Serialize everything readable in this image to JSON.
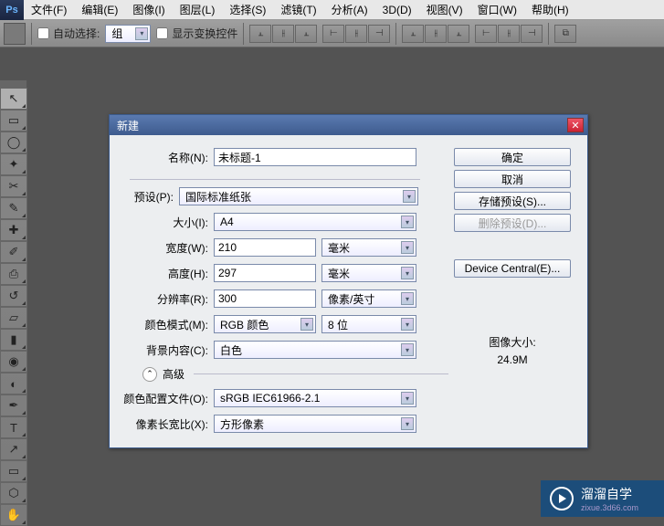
{
  "menubar": {
    "items": [
      "文件(F)",
      "编辑(E)",
      "图像(I)",
      "图层(L)",
      "选择(S)",
      "滤镜(T)",
      "分析(A)",
      "3D(D)",
      "视图(V)",
      "窗口(W)",
      "帮助(H)"
    ]
  },
  "optbar": {
    "auto_select": "自动选择:",
    "group_value": "组",
    "show_transform": "显示变换控件"
  },
  "dialog": {
    "title": "新建",
    "name_label": "名称(N):",
    "name_value": "未标题-1",
    "preset_label": "预设(P):",
    "preset_value": "国际标准纸张",
    "size_label": "大小(I):",
    "size_value": "A4",
    "width_label": "宽度(W):",
    "width_value": "210",
    "width_unit": "毫米",
    "height_label": "高度(H):",
    "height_value": "297",
    "height_unit": "毫米",
    "res_label": "分辨率(R):",
    "res_value": "300",
    "res_unit": "像素/英寸",
    "mode_label": "颜色模式(M):",
    "mode_value": "RGB 颜色",
    "bit_value": "8 位",
    "bg_label": "背景内容(C):",
    "bg_value": "白色",
    "adv_label": "高级",
    "profile_label": "颜色配置文件(O):",
    "profile_value": "sRGB IEC61966-2.1",
    "aspect_label": "像素长宽比(X):",
    "aspect_value": "方形像素",
    "ok": "确定",
    "cancel": "取消",
    "save_preset": "存储预设(S)...",
    "delete_preset": "删除预设(D)...",
    "device_central": "Device Central(E)...",
    "img_size_label": "图像大小:",
    "img_size_value": "24.9M"
  },
  "watermark": {
    "brand": "溜溜自学",
    "url": "zixue.3d66.com"
  }
}
